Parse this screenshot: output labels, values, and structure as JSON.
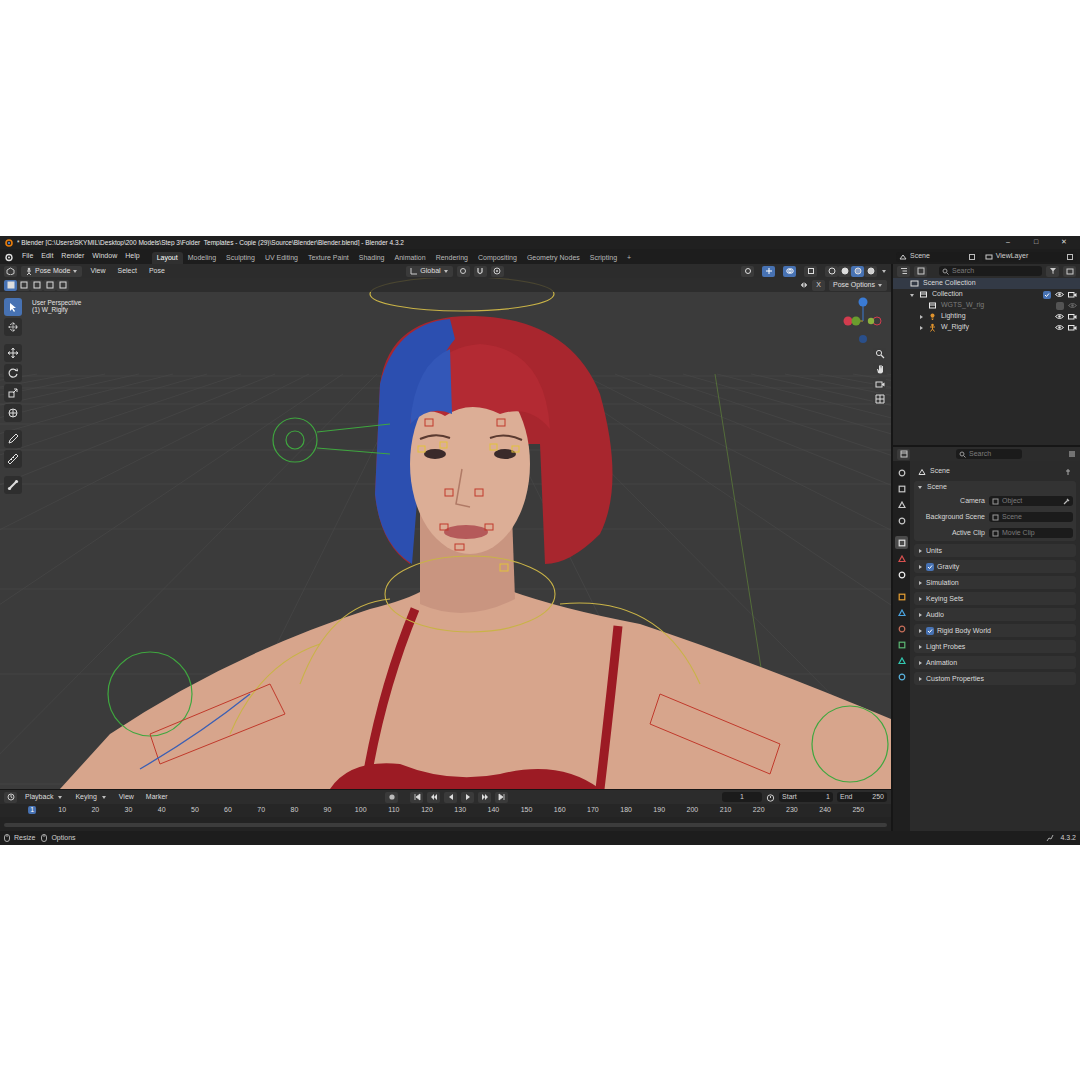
{
  "window": {
    "title": "* Blender [C:\\Users\\SKYMIL\\Desktop\\200 Models\\Step 3\\Folder_Templates - Copie (29)\\Source\\Blender\\Blender.blend] - Blender 4.3.2",
    "controls": [
      "–",
      "□",
      "✕"
    ]
  },
  "menus": [
    "File",
    "Edit",
    "Render",
    "Window",
    "Help"
  ],
  "workspaces": [
    {
      "label": "Layout",
      "selected": true
    },
    {
      "label": "Modeling",
      "selected": false
    },
    {
      "label": "Sculpting",
      "selected": false
    },
    {
      "label": "UV Editing",
      "selected": false
    },
    {
      "label": "Texture Paint",
      "selected": false
    },
    {
      "label": "Shading",
      "selected": false
    },
    {
      "label": "Animation",
      "selected": false
    },
    {
      "label": "Rendering",
      "selected": false
    },
    {
      "label": "Compositing",
      "selected": false
    },
    {
      "label": "Geometry Nodes",
      "selected": false
    },
    {
      "label": "Scripting",
      "selected": false
    }
  ],
  "add_workspace": "+",
  "scene": "Scene",
  "view_layer": "ViewLayer",
  "viewport": {
    "mode": "Pose Mode",
    "menus": [
      "View",
      "Select",
      "Pose"
    ],
    "orientation": "Global",
    "toggles": [
      {
        "on": false
      },
      {
        "on": true
      },
      {
        "on": true
      },
      {
        "on": false
      }
    ],
    "shading": [
      {
        "selected": false
      },
      {
        "selected": false
      },
      {
        "selected": true
      },
      {
        "selected": false
      }
    ],
    "select_modes": [
      {
        "selected": true
      },
      {
        "selected": false
      },
      {
        "selected": false
      },
      {
        "selected": false
      },
      {
        "selected": false
      }
    ],
    "mirror_x": {
      "label": "X",
      "on": false
    },
    "pose_options": "Pose Options",
    "perspective": "User Perspective",
    "object": "(1) W_Rigify",
    "tools": [
      {
        "selected": true
      },
      {
        "selected": false
      },
      {
        "selected": false
      },
      {
        "selected": false
      },
      {
        "selected": false
      },
      {
        "selected": false
      },
      {
        "selected": false
      },
      {
        "selected": false
      },
      {
        "selected": false
      }
    ]
  },
  "timeline": {
    "menus": [
      {
        "label": "Playback",
        "kind": "dropdown"
      },
      {
        "label": "Keying",
        "kind": "dropdown"
      },
      {
        "label": "View",
        "kind": "menu"
      },
      {
        "label": "Marker",
        "kind": "menu"
      }
    ],
    "current_frame": "1",
    "start_label": "Start",
    "start": "1",
    "end_label": "End",
    "end": "250",
    "ruler": [
      "1",
      "10",
      "20",
      "30",
      "40",
      "50",
      "60",
      "70",
      "80",
      "90",
      "100",
      "110",
      "120",
      "130",
      "140",
      "150",
      "160",
      "170",
      "180",
      "190",
      "200",
      "210",
      "220",
      "230",
      "240",
      "250"
    ]
  },
  "outliner": {
    "search": {
      "placeholder": "Search"
    },
    "tree": {
      "label": "Scene Collection",
      "kind": "scene",
      "children": [
        {
          "label": "Collection",
          "kind": "collection",
          "expanded": true,
          "checked": true,
          "visible": true,
          "renderable": true,
          "children": [
            {
              "label": "WGTS_W_rig",
              "kind": "collection",
              "enabled": false,
              "checked": false,
              "visible": false
            },
            {
              "label": "Lighting",
              "kind": "light",
              "expanded": false,
              "visible": true,
              "renderable": true
            },
            {
              "label": "W_Rigify",
              "kind": "armature",
              "expanded": false,
              "visible": true,
              "renderable": true
            }
          ]
        }
      ]
    }
  },
  "properties": {
    "search": {
      "placeholder": "Search"
    },
    "tabs": [
      {
        "selected": false
      },
      {
        "selected": false
      },
      {
        "selected": false
      },
      {
        "selected": false
      },
      {
        "selected": true
      },
      {
        "selected": false
      },
      {
        "selected": false
      },
      {
        "selected": false
      },
      {
        "selected": false
      },
      {
        "selected": false
      },
      {
        "selected": false
      },
      {
        "selected": false
      },
      {
        "selected": false
      }
    ],
    "context": "Scene",
    "panel": {
      "title": "Scene",
      "expanded": true,
      "fields": [
        {
          "label": "Camera",
          "value": "Object",
          "empty": true
        },
        {
          "label": "Background Scene",
          "value": "Scene",
          "empty": true
        },
        {
          "label": "Active Clip",
          "value": "Movie Clip",
          "empty": true
        }
      ]
    },
    "sections": [
      {
        "label": "Units",
        "kind": "plain",
        "expanded": false
      },
      {
        "label": "Gravity",
        "kind": "checkbox",
        "checked": true,
        "expanded": false
      },
      {
        "label": "Simulation",
        "kind": "plain",
        "expanded": false
      },
      {
        "label": "Keying Sets",
        "kind": "plain",
        "expanded": false
      },
      {
        "label": "Audio",
        "kind": "plain",
        "expanded": false
      },
      {
        "label": "Rigid Body World",
        "kind": "checkbox",
        "checked": true,
        "expanded": false
      },
      {
        "label": "Light Probes",
        "kind": "plain",
        "expanded": false
      },
      {
        "label": "Animation",
        "kind": "plain",
        "expanded": false
      },
      {
        "label": "Custom Properties",
        "kind": "plain",
        "expanded": false
      }
    ]
  },
  "status_bar": {
    "items": [
      "Resize",
      "Options"
    ],
    "version": "4.3.2"
  }
}
